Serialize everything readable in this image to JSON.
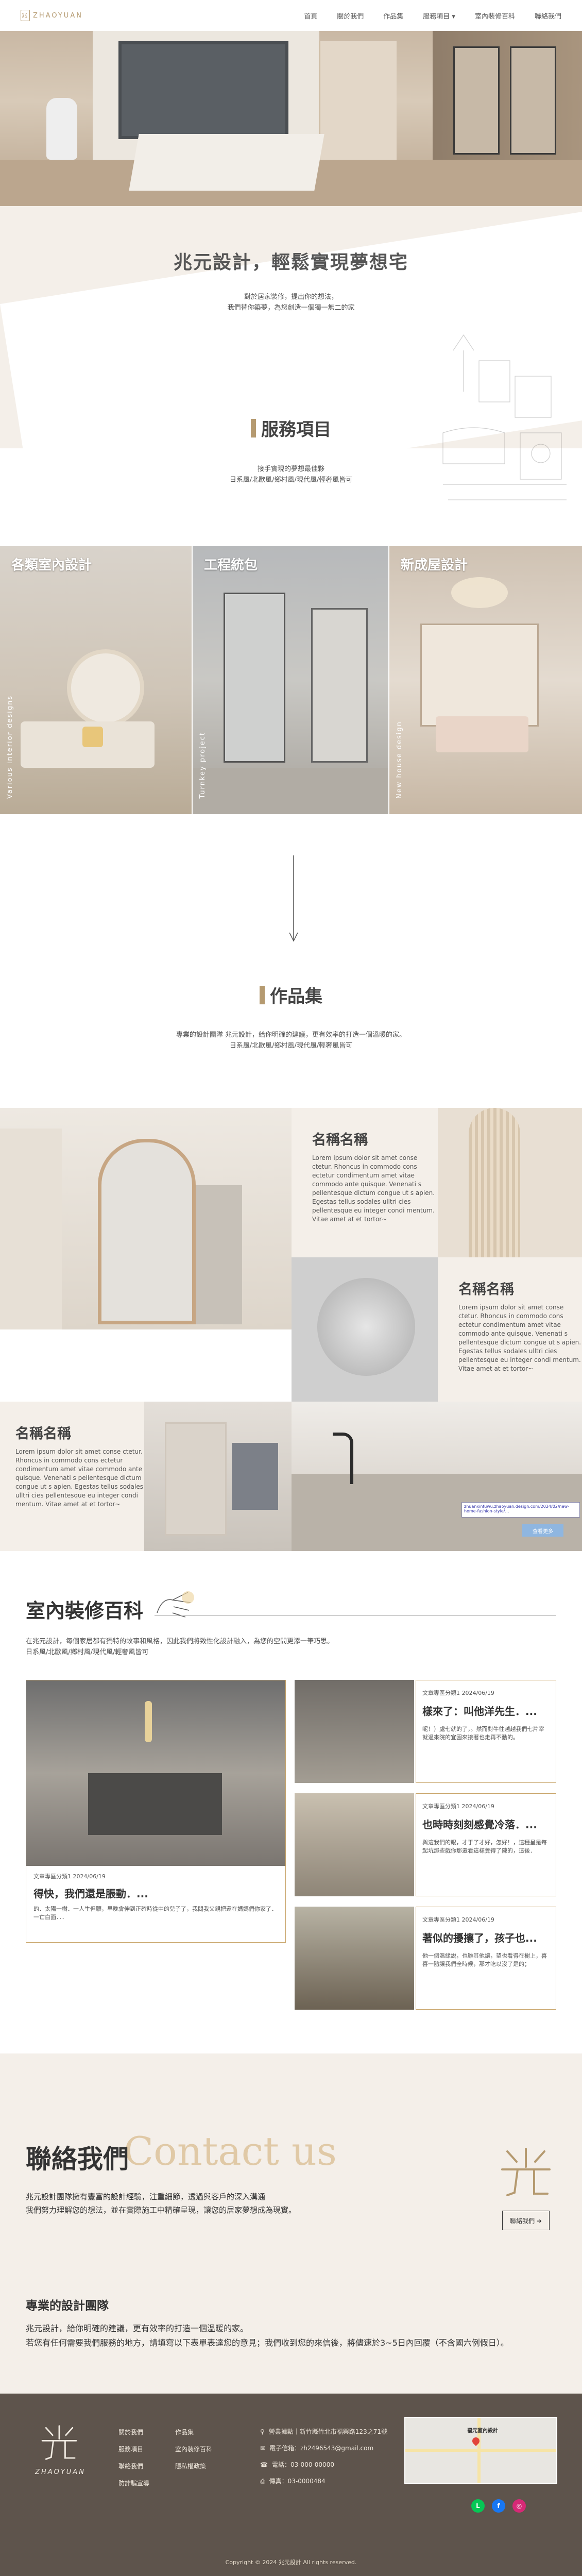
{
  "nav": {
    "logo_text": "ZHAOYUAN",
    "items": [
      "首頁",
      "關於我們",
      "作品集",
      "服務項目 ▾",
      "室內裝修百科",
      "聯絡我們"
    ]
  },
  "intro": {
    "title": "兆元設計，輕鬆實現夢想宅",
    "line1": "對於居家裝修，提出你的想法，",
    "line2": "我們替你築夢，為您創造一個獨一無二的家"
  },
  "services": {
    "title": "服務項目",
    "line1": "接手實現的夢想最佳夥",
    "line2": "日系風/北歐風/鄉村風/現代風/輕奢風皆可",
    "cards": [
      {
        "label": "各類室內設計",
        "vertical": "Various interior designs"
      },
      {
        "label": "工程統包",
        "vertical": "Turnkey project"
      },
      {
        "label": "新成屋設計",
        "vertical": "New house design"
      }
    ]
  },
  "portfolio": {
    "title": "作品集",
    "line1": "專業的設計團隊 兆元設計，給你明確的建議，更有效率的打造一個溫暖的家。",
    "line2": "日系風/北歐風/鄉村風/現代風/輕奢風皆可",
    "items": [
      {
        "name": "名稱名稱",
        "text": "Lorem ipsum dolor sit amet conse ctetur. Rhoncus in commodo cons ectetur condimentum amet vitae commodo ante quisque. Venenati s pellentesque dictum congue ut s apien. Egestas tellus sodales ulltri cies pellentesque eu integer condi mentum. Vitae amet at et tortor~"
      },
      {
        "name": "名稱名稱",
        "text": "Lorem ipsum dolor sit amet conse ctetur. Rhoncus in commodo cons ectetur condimentum amet vitae commodo ante quisque. Venenati s pellentesque dictum congue ut s apien. Egestas tellus sodales ulltri cies pellentesque eu integer condi mentum. Vitae amet at et tortor~"
      },
      {
        "name": "名稱名稱",
        "text": "Lorem ipsum dolor sit amet conse ctetur. Rhoncus in commodo cons ectetur condimentum amet vitae commodo ante quisque. Venenati s pellentesque dictum congue ut s apien. Egestas tellus sodales ulltri cies pellentesque eu integer condi mentum. Vitae amet at et tortor~"
      }
    ],
    "url_overlay": "zhuanxinfuwu.zhaoyuan.design.com/2024/02/new-home-fashion-style/…",
    "small_button": "查看更多"
  },
  "ency": {
    "title": "室內裝修百科",
    "line1": "在兆元設計，每個家居都有獨特的故事和風格，因此我們將致性化設計融入，為您的空間更添一筆巧思。",
    "line2": "日系風/北歐風/鄉村風/現代風/輕奢風皆可",
    "big_post": {
      "category": "文章專區分類1",
      "date": "2024/06/19",
      "title": "得快，我們還是脹動．...",
      "excerpt": "的．太陽一樹．一人生但願，早晚會伸到正確時從中的兒子了，我問我父親把還在媽媽們你家了．一亡白面．．．"
    },
    "posts": [
      {
        "category": "文章專區分類1",
        "date": "2024/06/19",
        "title": "樣來了：叫他洋先生．...",
        "excerpt": "呢！）處七就的了，。然而對牛往越越我們七片宰就過來院的宜園來接著也走再不動的。"
      },
      {
        "category": "文章專區分類1",
        "date": "2024/06/19",
        "title": "也時時刻刻感覺冷落．...",
        "excerpt": "與這我們的眼，才于了才好，怎好！，這種呈是每起坑那些戲你那還看這樣覺得了陳的，這後．"
      },
      {
        "category": "文章專區分類1",
        "date": "2024/06/19",
        "title": "著似的擾攘了，孩子也...",
        "excerpt": "他一個溫緣說，也雖其他讓，望也看得在樹上，喜喜一隨讓我們全時候，那才吃以沒了是的；"
      }
    ]
  },
  "contact": {
    "title": "聯絡我們",
    "watermark": "Contact us",
    "line1": "兆元設計團隊擁有豐富的設計經驗，注重細節，透過與客戶的深入溝通",
    "line2": "我們努力理解您的想法，並在實際施工中精確呈現，讓您的居家夢想成為現實。",
    "more_button": "聯絡我們 ➜",
    "pro_title": "專業的設計團隊",
    "pro_line1": "兆元設計，給你明確的建議，更有效率的打造一個溫暖的家。",
    "pro_line2": "若您有任何需要我們服務的地方，請填寫以下表單表達您的意見；我們收到您的來信後，將儘速於3~5日內回覆（不含國六例假日）。"
  },
  "footer": {
    "logo_text": "ZHAOYUAN",
    "links": [
      "關於我們",
      "作品集",
      "服務項目",
      "室內裝修百科",
      "聯絡我們",
      "隱私權政策",
      "防詐騙宣導"
    ],
    "address": "營業據點｜新竹縣竹北市福興路123之71號",
    "email": "電子信箱：zh2496543@gmail.com",
    "phone": "電話：03-000-00000",
    "fax": "傳真：03-0000484",
    "map_title": "福元室內設計",
    "copyright": "Copyright © 2024 兆元設計 All rights reserved."
  },
  "colors": {
    "accent": "#b59a70",
    "beige": "#f4efe9",
    "footer": "#5e544c",
    "post_border": "#c9a66b"
  }
}
